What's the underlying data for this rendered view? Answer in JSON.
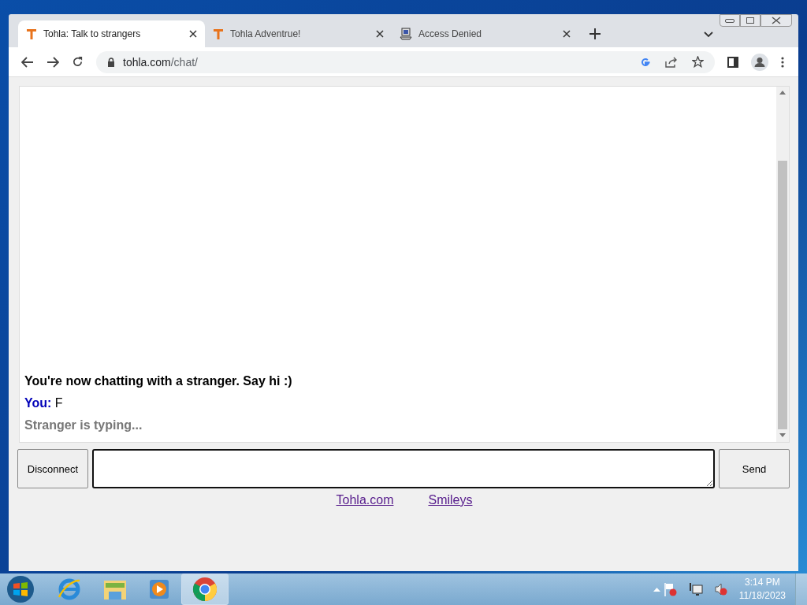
{
  "browser": {
    "tabs": [
      {
        "title": "Tohla: Talk to strangers",
        "selected": true,
        "kind": "tohla"
      },
      {
        "title": "Tohla Adventrue!",
        "selected": false,
        "kind": "tohla"
      },
      {
        "title": "Access Denied",
        "selected": false,
        "kind": "computer"
      }
    ],
    "address_host": "tohla.com",
    "address_path": "/chat/"
  },
  "chat": {
    "messages": [
      {
        "kind": "system",
        "text": "You're now chatting with a stranger. Say hi :)"
      },
      {
        "kind": "you",
        "label": "You:",
        "text": "F"
      },
      {
        "kind": "status",
        "text": "Stranger is typing..."
      }
    ],
    "disconnect": "Disconnect",
    "send": "Send",
    "links": [
      "Tohla.com",
      "Smileys"
    ]
  },
  "taskbar": {
    "time": "3:14 PM",
    "date": "11/18/2023"
  }
}
